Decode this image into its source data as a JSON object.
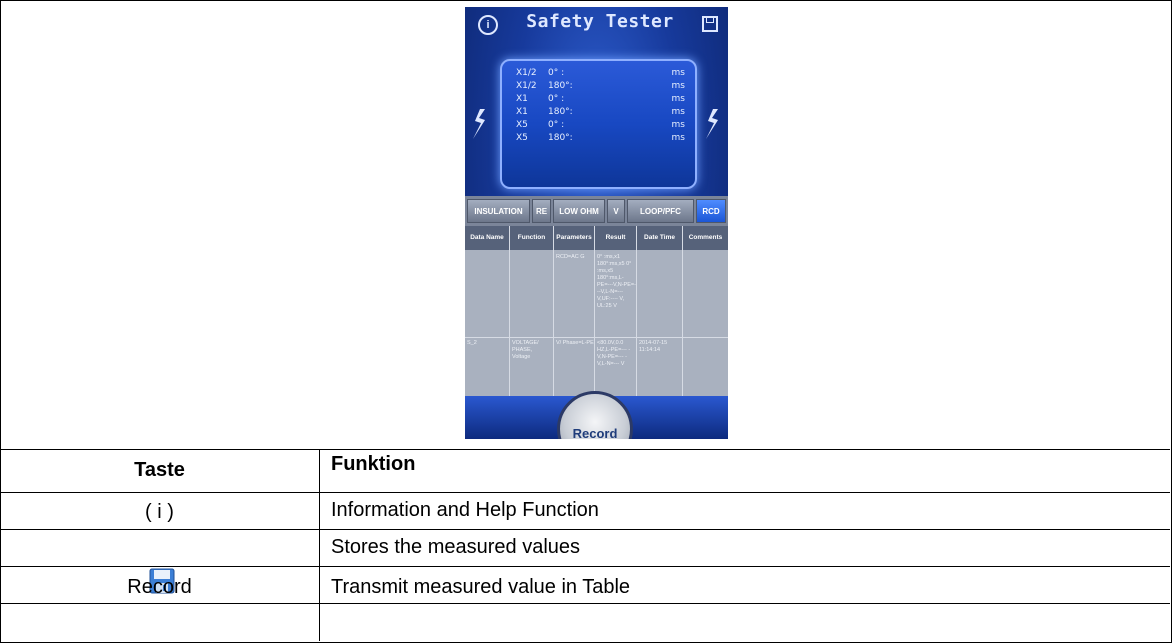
{
  "phone": {
    "title": "Safety Tester",
    "info_glyph": "i",
    "icons": {
      "info": "info-icon",
      "save": "save-icon",
      "spark": "spark-icon"
    },
    "results": [
      {
        "mult": "X1/2",
        "angle": "0° :",
        "unit": "ms"
      },
      {
        "mult": "X1/2",
        "angle": "180°:",
        "unit": "ms"
      },
      {
        "mult": "X1",
        "angle": "0° :",
        "unit": "ms"
      },
      {
        "mult": "X1",
        "angle": "180°:",
        "unit": "ms"
      },
      {
        "mult": "X5",
        "angle": "0° :",
        "unit": "ms"
      },
      {
        "mult": "X5",
        "angle": "180°:",
        "unit": "ms"
      }
    ],
    "tabs": [
      "INSULATION",
      "RE",
      "LOW OHM",
      "V",
      "LOOP/PFC",
      "RCD"
    ],
    "active_tab": "RCD",
    "table_headers": [
      "Data Name",
      "Function",
      "Parameters",
      "Result",
      "Date Time",
      "Comments"
    ],
    "rows": [
      {
        "data_name": "",
        "function": "",
        "parameters": "RCD=AC G",
        "result": "0° :ms,x1 180°:ms,x5 0° :ms,x5 180°:ms,L-PE=---V,N-PE=---V,L-N=---V,UF:---- V, UL:25 V",
        "date_time": "",
        "comments": ""
      },
      {
        "data_name": "S_2",
        "function": "VOLTAGE/ PHASE, Voltage",
        "parameters": "V/ Phase=L-PE",
        "result": "<80.0V,0.0 HZ,L-PE=--- -V,N-PE=--- -V,L-N=--- V",
        "date_time": "2014-07-15 11:14:14",
        "comments": ""
      }
    ],
    "record_label": "Record"
  },
  "table": {
    "header_key": "Taste",
    "header_value": "Funktion",
    "rows": [
      {
        "key": "( i )",
        "value": "Information and Help Function"
      },
      {
        "key": "",
        "key_icon": "floppy-disk-icon",
        "value": "Stores the measured values"
      },
      {
        "key": "Record",
        "value": "Transmit measured value in Table"
      }
    ]
  },
  "colors": {
    "phone_blue": "#173a9c",
    "tab_active": "#1b56d6",
    "floppy": "#3c7fd6"
  }
}
